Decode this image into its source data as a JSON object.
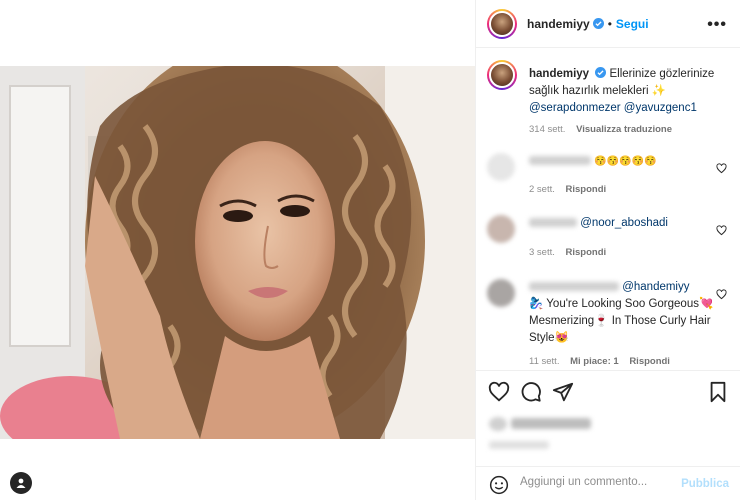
{
  "post": {
    "media_alt": "",
    "author": "handemiyy",
    "follow_label": "Segui",
    "separator": "•",
    "more_label": "•••"
  },
  "caption": {
    "author": "handemiyy",
    "text": "Ellerinize gözlerinize sağlık hazırlık melekleri",
    "emoji": "✨",
    "mentions": [
      "@serapdonmezer",
      "@yavuzgenc1"
    ],
    "time": "314 sett.",
    "translate_label": "Visualizza traduzione"
  },
  "comments": [
    {
      "emoji_text": "😚😚😚😚😚",
      "time": "2 sett.",
      "reply_label": "Rispondi"
    },
    {
      "mention": "@noor_aboshadi",
      "time": "3 sett.",
      "reply_label": "Rispondi"
    },
    {
      "mention": "@handemiyy",
      "text": "🧞‍♀️ You're Looking Soo Gorgeous💘 Mesmerizing🍷 In Those Curly Hair Style😻",
      "time": "11 sett.",
      "likes_label": "Mi piace: 1",
      "reply_label": "Rispondi"
    }
  ],
  "actions": {
    "like_icon": "heart-icon",
    "comment_icon": "comment-icon",
    "share_icon": "share-icon",
    "save_icon": "bookmark-icon"
  },
  "add_comment": {
    "placeholder": "Aggiungi un commento...",
    "publish_label": "Pubblica"
  },
  "colors": {
    "accent": "#0095f6",
    "publish_disabled": "#b2dffc",
    "mention": "#00376b",
    "muted": "#8e8e8e"
  }
}
